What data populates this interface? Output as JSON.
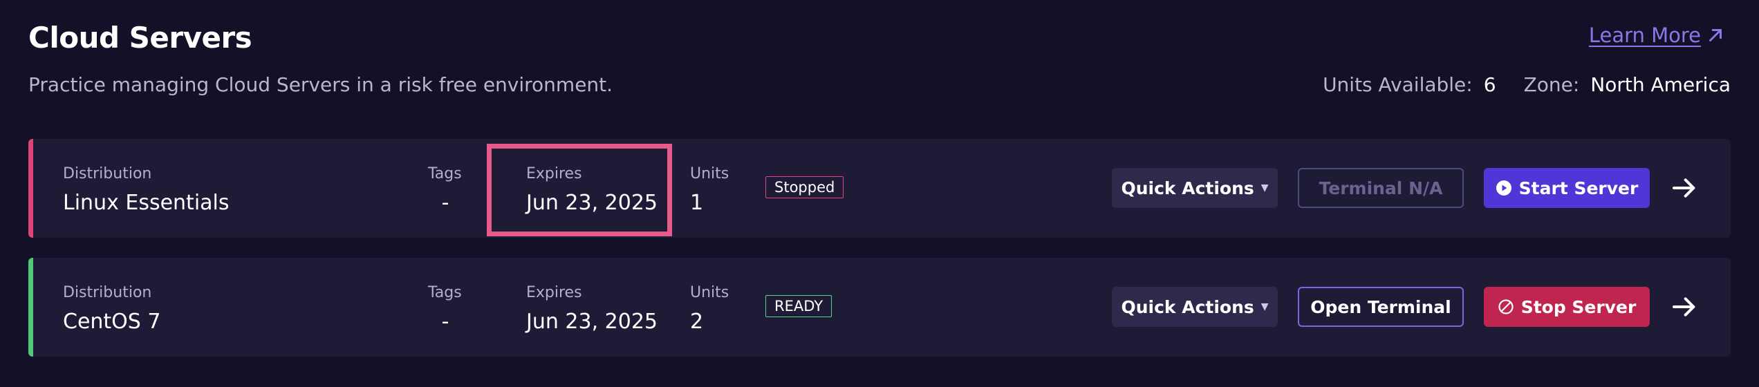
{
  "header": {
    "title": "Cloud Servers",
    "subtitle": "Practice managing Cloud Servers in a risk free environment.",
    "learn_more": "Learn More",
    "units_available_label": "Units Available:",
    "units_available_value": "6",
    "zone_label": "Zone:",
    "zone_value": "North America"
  },
  "columns": {
    "distribution": "Distribution",
    "tags": "Tags",
    "expires": "Expires",
    "units": "Units"
  },
  "servers": [
    {
      "distribution": "Linux Essentials",
      "tags": "-",
      "expires": "Jun 23, 2025",
      "units": "1",
      "status": "Stopped",
      "quick_actions": "Quick Actions",
      "terminal": "Terminal N/A",
      "server_action": "Start Server",
      "accent_color": "#e0427c",
      "status_color": "#e0427c"
    },
    {
      "distribution": "CentOS 7",
      "tags": "-",
      "expires": "Jun 23, 2025",
      "units": "2",
      "status": "READY",
      "quick_actions": "Quick Actions",
      "terminal": "Open Terminal",
      "server_action": "Stop Server",
      "accent_color": "#4fc976",
      "status_color": "#5fd38a"
    }
  ],
  "icons": {
    "learn_more": "arrow-up-right-icon",
    "quick_actions": "chevron-down-icon",
    "start": "play-circle-icon",
    "stop": "prohibited-icon",
    "row_link": "arrow-right-icon"
  }
}
